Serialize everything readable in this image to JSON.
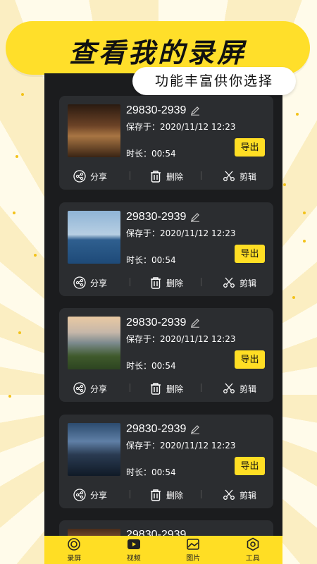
{
  "banner": {
    "title": "查看我的录屏",
    "subtitle": "功能丰富供你选择"
  },
  "recordings": [
    {
      "name": "29830-2939",
      "saved": "保存于：2020/11/12  12:23",
      "duration": "时长：00:54",
      "export_label": "导出",
      "share_label": "分享",
      "delete_label": "删除",
      "edit_label": "剪辑",
      "thumb": "library-interior"
    },
    {
      "name": "29830-2939",
      "saved": "保存于：2020/11/12  12:23",
      "duration": "时长：00:54",
      "export_label": "导出",
      "share_label": "分享",
      "delete_label": "删除",
      "edit_label": "剪辑",
      "thumb": "lake-tree"
    },
    {
      "name": "29830-2939",
      "saved": "保存于：2020/11/12  12:23",
      "duration": "时长：00:54",
      "export_label": "导出",
      "share_label": "分享",
      "delete_label": "删除",
      "edit_label": "剪辑",
      "thumb": "town-landscape"
    },
    {
      "name": "29830-2939",
      "saved": "保存于：2020/11/12  12:23",
      "duration": "时长：00:54",
      "export_label": "导出",
      "share_label": "分享",
      "delete_label": "删除",
      "edit_label": "剪辑",
      "thumb": "night-highway"
    }
  ],
  "partial_recording": {
    "name": "29830-2939"
  },
  "tabbar": {
    "items": [
      {
        "label": "录屏",
        "icon": "record-icon"
      },
      {
        "label": "视频",
        "icon": "video-icon"
      },
      {
        "label": "图片",
        "icon": "image-icon"
      },
      {
        "label": "工具",
        "icon": "tools-icon"
      }
    ]
  },
  "colors": {
    "accent": "#ffde24",
    "card": "#2b2d30",
    "panel": "#1b1c1e"
  }
}
